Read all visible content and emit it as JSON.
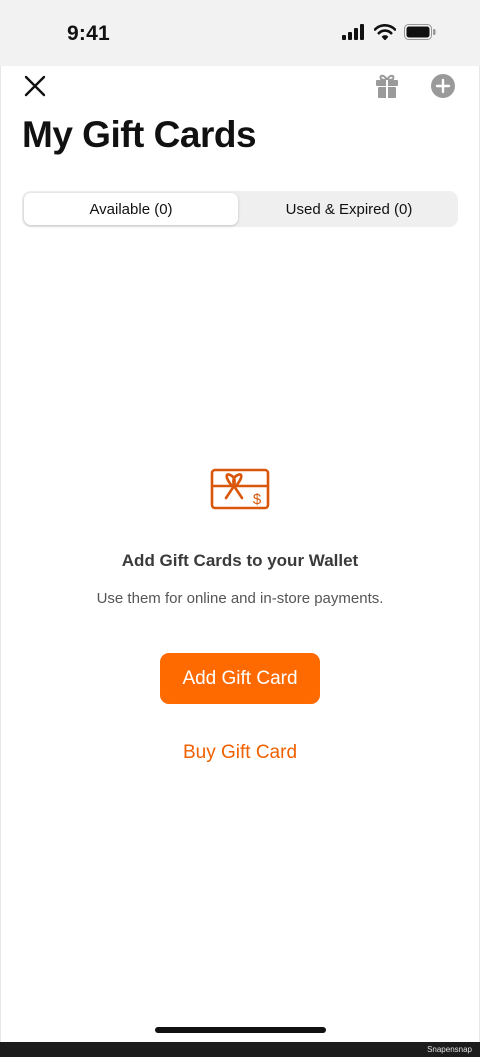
{
  "status_bar": {
    "time": "9:41",
    "icons": [
      "signal-icon",
      "wifi-icon",
      "battery-icon"
    ]
  },
  "toolbar": {
    "close_icon": "close-icon",
    "gift_icon": "gift-icon",
    "add_icon": "plus-circle-icon"
  },
  "header": {
    "title": "My Gift Cards"
  },
  "tabs": [
    {
      "label": "Available (0)",
      "selected": true
    },
    {
      "label": "Used & Expired (0)",
      "selected": false
    }
  ],
  "empty_state": {
    "icon": "gift-card-icon",
    "title": "Add Gift Cards to your Wallet",
    "subtitle": "Use them for online and in-store payments.",
    "primary_button": "Add Gift Card",
    "secondary_link": "Buy Gift Card"
  },
  "watermark": "Snapensnap",
  "colors": {
    "accent": "#ff6a00",
    "link": "#f06000",
    "icon_gray": "#9a9a9a",
    "icon_orange": "#d9560a"
  }
}
